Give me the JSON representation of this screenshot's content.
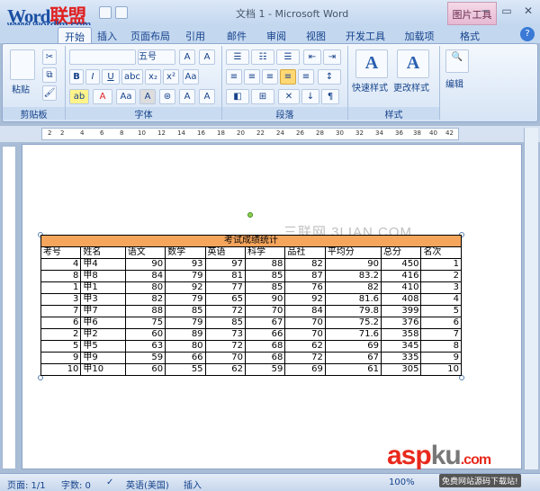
{
  "title_bar": {
    "logo": {
      "word": "Word",
      "cn": "联盟",
      "url": "www.wordlm.com"
    },
    "doc_title": "文档 1 - Microsoft Word",
    "contextual_tab": "图片工具",
    "window_buttons": [
      "−",
      "▭",
      "✕"
    ]
  },
  "tabs": [
    "开始",
    "插入",
    "页面布局",
    "引用",
    "邮件",
    "审阅",
    "视图",
    "开发工具",
    "加载项",
    "格式"
  ],
  "active_tab": "开始",
  "ribbon": {
    "clipboard": {
      "label": "剪贴板",
      "paste": "粘贴"
    },
    "font": {
      "label": "字体",
      "font_name": "",
      "font_size": "五号",
      "buttons": [
        "B",
        "I",
        "U",
        "abc",
        "x₂",
        "x²",
        "A",
        "A"
      ]
    },
    "paragraph": {
      "label": "段落"
    },
    "styles": {
      "label": "样式",
      "quick_styles": "快速样式",
      "change_styles": "更改样式"
    },
    "editing": {
      "label": "编辑",
      "edit": "编辑"
    }
  },
  "ruler_numbers": [
    "2",
    "2",
    "4",
    "6",
    "8",
    "10",
    "12",
    "14",
    "16",
    "18",
    "20",
    "22",
    "24",
    "26",
    "28",
    "30",
    "32",
    "34",
    "36",
    "38",
    "40",
    "42",
    "44"
  ],
  "page_watermark": "三联网 3LIAN.COM",
  "table": {
    "title": "考试成绩统计",
    "headers": [
      "考号",
      "姓名",
      "语文",
      "数学",
      "英语",
      "科学",
      "品社",
      "平均分",
      "总分",
      "名次"
    ],
    "rows": [
      [
        "4",
        "甲4",
        "90",
        "93",
        "97",
        "88",
        "82",
        "90",
        "450",
        "1"
      ],
      [
        "8",
        "甲8",
        "84",
        "79",
        "81",
        "85",
        "87",
        "83.2",
        "416",
        "2"
      ],
      [
        "1",
        "甲1",
        "80",
        "92",
        "77",
        "85",
        "76",
        "82",
        "410",
        "3"
      ],
      [
        "3",
        "甲3",
        "82",
        "79",
        "65",
        "90",
        "92",
        "81.6",
        "408",
        "4"
      ],
      [
        "7",
        "甲7",
        "88",
        "85",
        "72",
        "70",
        "84",
        "79.8",
        "399",
        "5"
      ],
      [
        "6",
        "甲6",
        "75",
        "79",
        "85",
        "67",
        "70",
        "75.2",
        "376",
        "6"
      ],
      [
        "2",
        "甲2",
        "60",
        "89",
        "73",
        "66",
        "70",
        "71.6",
        "358",
        "7"
      ],
      [
        "5",
        "甲5",
        "63",
        "80",
        "72",
        "68",
        "62",
        "69",
        "345",
        "8"
      ],
      [
        "9",
        "甲9",
        "59",
        "66",
        "70",
        "68",
        "72",
        "67",
        "335",
        "9"
      ],
      [
        "10",
        "甲10",
        "60",
        "55",
        "62",
        "59",
        "69",
        "61",
        "305",
        "10"
      ]
    ]
  },
  "status_bar": {
    "page": "页面: 1/1",
    "words": "字数: 0",
    "language": "英语(美国)",
    "mode": "插入",
    "zoom": "100%"
  },
  "corner_watermark": {
    "asp": "asp",
    "ku": "ku",
    "com": ".com",
    "subtitle": "免费网站源码下载站!"
  }
}
